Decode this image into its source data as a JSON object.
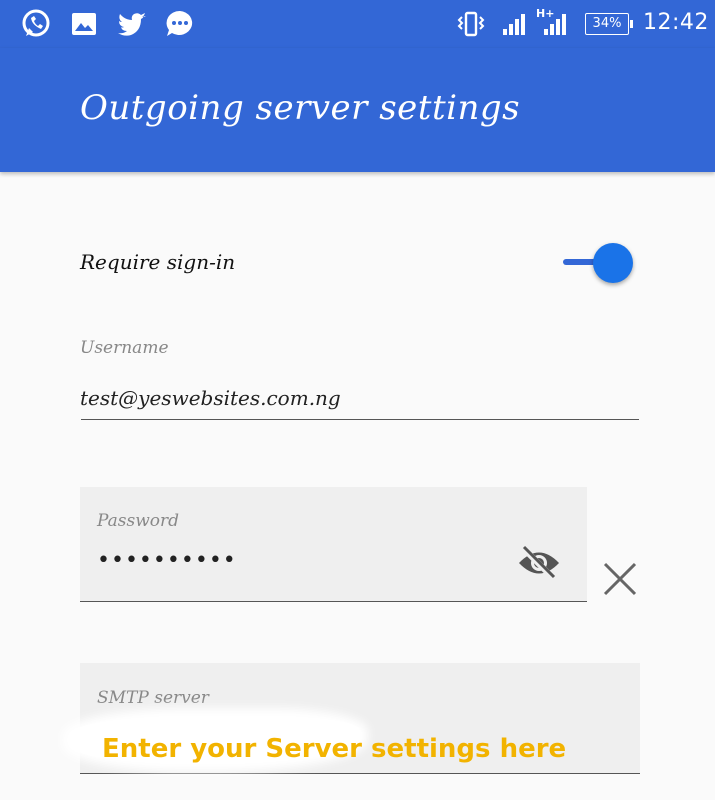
{
  "status_bar": {
    "icons": [
      "whatsapp-icon",
      "gallery-icon",
      "twitter-icon",
      "chat-icon"
    ],
    "right_icons": [
      "vibrate-icon",
      "signal-icon",
      "signal-hplus-icon"
    ],
    "network_label": "H+",
    "battery": "34%",
    "time": "12:42"
  },
  "app_bar": {
    "title": "Outgoing server settings"
  },
  "settings": {
    "require_signin": {
      "label": "Require sign-in",
      "enabled": true
    },
    "username": {
      "label": "Username",
      "value": "test@yeswebsites.com.ng"
    },
    "password": {
      "label": "Password",
      "value": "••••••••••",
      "visibility_icon": "eye-off-icon",
      "clear_icon": "close-icon"
    },
    "smtp_server": {
      "label": "SMTP server"
    }
  },
  "annotation": "Enter your Server settings here",
  "colors": {
    "primary": "#3367d6",
    "accent": "#1a73e8",
    "annotation": "#f2b300"
  }
}
